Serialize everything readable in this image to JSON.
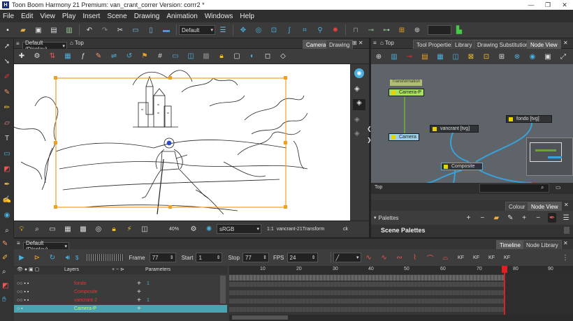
{
  "window": {
    "title": "Toon Boom Harmony 21 Premium: van_crant_correr Version: corrr2 *",
    "app_icon": "H",
    "min": "—",
    "max": "❐",
    "close": "✕"
  },
  "menu": [
    "File",
    "Edit",
    "View",
    "Play",
    "Insert",
    "Scene",
    "Drawing",
    "Animation",
    "Windows",
    "Help"
  ],
  "toolbar": {
    "workspace": "Default"
  },
  "camera": {
    "display": "Default (Display)",
    "view": "Top",
    "tabs": [
      "Camera",
      "Drawing"
    ],
    "zoom": "40%",
    "colorspace": "sRGB",
    "ratio": "1:1",
    "node_name": "vancrant-21Transform",
    "ck": "ck"
  },
  "nodeview": {
    "view": "Top",
    "tabs": [
      "Tool Properties",
      "Library",
      "Drawing Substitutions",
      "Node View"
    ],
    "nodes": {
      "transformation": "Transformation",
      "camera_p": "Camera-P",
      "camera": "Camera",
      "vancrant": "vancrant  [tvg]",
      "fondo": "fondo  [tvg]",
      "composite": "Composite"
    },
    "breadcrumb": "Top"
  },
  "palettes": {
    "tabs": [
      "Colour",
      "Node View"
    ],
    "title": "Palettes",
    "scene_palettes": "Scene Palettes"
  },
  "timeline": {
    "display": "Default (Display)",
    "tabs": [
      "Timeline",
      "Node Library"
    ],
    "frame_label": "Frame",
    "frame": "77",
    "start_label": "Start",
    "start": "1",
    "stop_label": "Stop",
    "stop": "77",
    "fps_label": "FPS",
    "fps": "24",
    "layers_header": "Layers",
    "params_header": "Parameters",
    "ruler": [
      "10",
      "20",
      "30",
      "40",
      "50",
      "60",
      "70",
      "80",
      "90"
    ],
    "layers": [
      {
        "name": "fondo",
        "param": "1"
      },
      {
        "name": "Composite",
        "param": ""
      },
      {
        "name": "vancrant-2",
        "param": "1"
      },
      {
        "name": "Camera-P",
        "param": ""
      }
    ],
    "kf_label": "KF"
  },
  "colors": {
    "accent_orange": "#f0a020",
    "node_green": "#9ed44c",
    "node_blue": "#8ac8e8",
    "wire_blue": "#3aa0d8",
    "selection_teal": "#4aa3b0",
    "playhead_red": "#e02020"
  }
}
